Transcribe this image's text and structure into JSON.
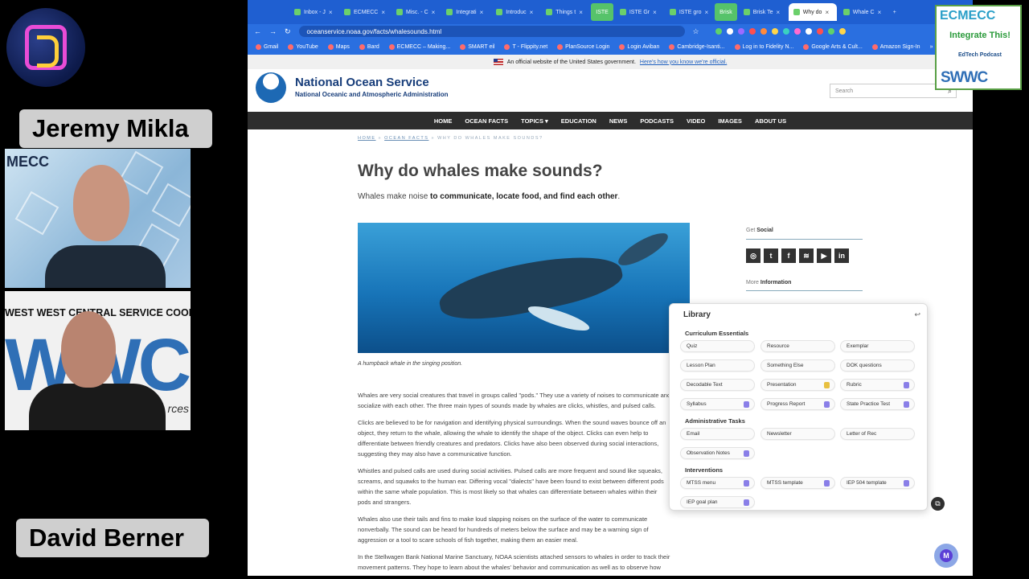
{
  "participants": {
    "presenter1": "Jeremy Mikla",
    "presenter2": "David Berner",
    "video1_backdrop": "MECC",
    "video2_banner": "WEST WEST CENTRAL SERVICE COOPE",
    "video2_letters": "WWC",
    "video2_footer": "rces"
  },
  "podcast_logo": {
    "org": "ECMECC",
    "title": "Integrate This!",
    "subtitle": "EdTech Podcast",
    "partner": "SWWC"
  },
  "browser": {
    "tabs": [
      {
        "label": "Inbox - J"
      },
      {
        "label": "ECMECC"
      },
      {
        "label": "Misc. - C"
      },
      {
        "label": "Integrati"
      },
      {
        "label": "Introduc"
      },
      {
        "label": "Things t"
      },
      {
        "label": "ISTE",
        "badge": true
      },
      {
        "label": "ISTE Gr"
      },
      {
        "label": "ISTE gro"
      },
      {
        "label": "Brisk",
        "badge": true
      },
      {
        "label": "Brisk Te"
      },
      {
        "label": "Why do",
        "active": true
      },
      {
        "label": "Whale C"
      }
    ],
    "new_tab": "+",
    "url": "oceanservice.noaa.gov/facts/whalesounds.html",
    "bookmarks": [
      "Gmail",
      "YouTube",
      "Maps",
      "Bard",
      "ECMECC – Making...",
      "SMART eil",
      "T - Flippity.net",
      "PlanSource Login",
      "Login Aviban",
      "Cambridge-Isanti...",
      "Log in to Fidelity N...",
      "Google Arts & Cult...",
      "Amazon Sign-In"
    ],
    "bookmark_more": "»"
  },
  "gov_banner": {
    "text": "An official website of the United States government.",
    "link": "Here's how you know we're official."
  },
  "site": {
    "title": "National Ocean Service",
    "subtitle": "National Oceanic and Atmospheric Administration",
    "search_placeholder": "Search",
    "nav": [
      "HOME",
      "OCEAN FACTS",
      "TOPICS ▾",
      "EDUCATION",
      "NEWS",
      "PODCASTS",
      "VIDEO",
      "IMAGES",
      "ABOUT US"
    ]
  },
  "article": {
    "breadcrumb_home": "HOME",
    "breadcrumb_facts": "OCEAN FACTS",
    "breadcrumb_current": "WHY DO WHALES MAKE SOUNDS?",
    "breadcrumb_sep": "»",
    "title": "Why do whales make sounds?",
    "intro_plain": "Whales make noise ",
    "intro_bold": "to communicate, locate food, and find each other",
    "intro_end": ".",
    "caption": "A humpback whale in the singing position.",
    "paragraphs": [
      "Whales are very social creatures that travel in groups called \"pods.\" They use a variety of noises to communicate and socialize with each other. The three main types of sounds made by whales are clicks, whistles, and pulsed calls.",
      "Clicks are believed to be for navigation and identifying physical surroundings. When the sound waves bounce off an object, they return to the whale, allowing the whale to identify the shape of the object. Clicks can even help to differentiate between friendly creatures and predators. Clicks have also been observed during social interactions, suggesting they may also have a communicative function.",
      "Whistles and pulsed calls are used during social activities. Pulsed calls are more frequent and sound like squeaks, screams, and squawks to the human ear. Differing vocal \"dialects\" have been found to exist between different pods within the same whale population. This is most likely so that whales can differentiate between whales within their pods and strangers.",
      "Whales also use their tails and fins to make loud slapping noises on the surface of the water to communicate nonverbally. The sound can be heard for hundreds of meters below the surface and may be a warning sign of aggression or a tool to scare schools of fish together, making them an easier meal.",
      "In the Stellwagen Bank National Marine Sanctuary, NOAA scientists attached sensors to whales in order to track their movement patterns. They hope to learn about the whales' behavior and communication as well as to observe how"
    ]
  },
  "sidebar": {
    "social_prefix": "Get ",
    "social_bold": "Social",
    "social_icons": [
      "instagram-icon",
      "twitter-icon",
      "facebook-icon",
      "rss-icon",
      "youtube-icon",
      "linkedin-icon"
    ],
    "social_glyphs": [
      "◎",
      "t",
      "f",
      "≋",
      "▶",
      "in"
    ],
    "more_prefix": "More ",
    "more_bold": "Information"
  },
  "library": {
    "title": "Library",
    "close": "↩",
    "sections": [
      {
        "name": "Curriculum Essentials",
        "items": [
          {
            "label": "Quiz",
            "badge": ""
          },
          {
            "label": "Resource",
            "badge": ""
          },
          {
            "label": "Exemplar",
            "badge": ""
          },
          {
            "label": "Lesson Plan",
            "badge": ""
          },
          {
            "label": "Something Else",
            "badge": ""
          },
          {
            "label": "DOK questions",
            "badge": ""
          },
          {
            "label": "Decodable Text",
            "badge": ""
          },
          {
            "label": "Presentation",
            "badge": "gold"
          },
          {
            "label": "Rubric",
            "badge": "purple"
          },
          {
            "label": "Syllabus",
            "badge": "purple"
          },
          {
            "label": "Progress Report",
            "badge": "purple"
          },
          {
            "label": "State Practice Test",
            "badge": "purple"
          }
        ]
      },
      {
        "name": "Administrative Tasks",
        "items": [
          {
            "label": "Email",
            "badge": ""
          },
          {
            "label": "Newsletter",
            "badge": ""
          },
          {
            "label": "Letter of Rec",
            "badge": ""
          },
          {
            "label": "Observation Notes",
            "badge": "purple"
          }
        ]
      },
      {
        "name": "Interventions",
        "items": [
          {
            "label": "MTSS menu",
            "badge": "purple"
          },
          {
            "label": "MTSS template",
            "badge": "purple"
          },
          {
            "label": "IEP 504 template",
            "badge": "purple"
          },
          {
            "label": "IEP goal plan",
            "badge": "purple"
          }
        ]
      }
    ]
  },
  "brisk_button": "M"
}
